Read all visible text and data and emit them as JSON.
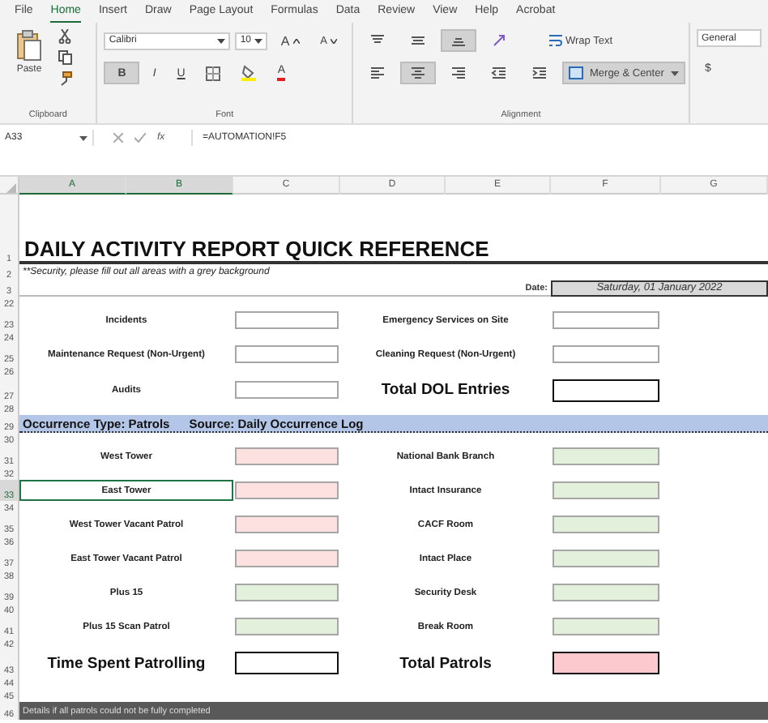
{
  "ribbon": {
    "tabs": [
      {
        "label": "File",
        "selected": false
      },
      {
        "label": "Home",
        "selected": true
      },
      {
        "label": "Insert",
        "selected": false
      },
      {
        "label": "Draw",
        "selected": false
      },
      {
        "label": "Page Layout",
        "selected": false
      },
      {
        "label": "Formulas",
        "selected": false
      },
      {
        "label": "Data",
        "selected": false
      },
      {
        "label": "Review",
        "selected": false
      },
      {
        "label": "View",
        "selected": false
      },
      {
        "label": "Help",
        "selected": false
      },
      {
        "label": "Acrobat",
        "selected": false
      }
    ],
    "clipboard": {
      "paste": "Paste",
      "group": "Clipboard"
    },
    "font": {
      "family": "Calibri",
      "size": "10",
      "grow": "A",
      "shrink": "A",
      "group": "Font",
      "buttons": [
        {
          "kind": "bold",
          "label": "B",
          "pressed": true
        },
        {
          "kind": "italic",
          "label": "I",
          "pressed": false
        },
        {
          "kind": "underline",
          "label": "U",
          "pressed": false
        },
        {
          "kind": "borders",
          "pressed": false
        },
        {
          "kind": "fill",
          "pressed": false
        },
        {
          "kind": "color",
          "label": "A",
          "pressed": false
        }
      ]
    },
    "alignment": {
      "group": "Alignment",
      "wrap": "Wrap Text",
      "merge": {
        "label": "Merge & Center",
        "pressed": true
      },
      "top": [
        {
          "kind": "top",
          "pressed": false
        },
        {
          "kind": "middle",
          "pressed": false
        },
        {
          "kind": "bottom",
          "pressed": true
        },
        {
          "kind": "orientation",
          "pressed": false
        }
      ],
      "bottom": [
        {
          "kind": "left",
          "pressed": false
        },
        {
          "kind": "center",
          "pressed": true
        },
        {
          "kind": "right",
          "pressed": false
        },
        {
          "kind": "outdent",
          "pressed": false
        },
        {
          "kind": "indent",
          "pressed": false
        }
      ]
    },
    "number": {
      "format": "General",
      "currency": "$"
    }
  },
  "formula_bar": {
    "name_box": "A33",
    "fx": "fx",
    "formula": "=AUTOMATION!F5"
  },
  "sheet": {
    "columns": [
      {
        "label": "A",
        "selected": true
      },
      {
        "label": "B",
        "selected": true
      },
      {
        "label": "C",
        "selected": false
      },
      {
        "label": "D",
        "selected": false
      },
      {
        "label": "E",
        "selected": false
      },
      {
        "label": "F",
        "selected": false
      },
      {
        "label": "G",
        "selected": false
      }
    ],
    "rows": [
      {
        "num": "1",
        "kind": "title",
        "text": "DAILY ACTIVITY REPORT QUICK REFERENCE"
      },
      {
        "num": "2",
        "kind": "note",
        "text": "**Security, please fill out all areas with a grey background"
      },
      {
        "num": "3",
        "kind": "date",
        "label": "Date:",
        "value": "Saturday, 01 January 2022"
      },
      {
        "num": "22",
        "kind": "blank"
      },
      {
        "num": "23",
        "kind": "pair",
        "left": {
          "label": "Incidents",
          "kind": "field",
          "color": "#ffffff",
          "selected": false
        },
        "right": {
          "label": "Emergency Services on Site",
          "kind": "field",
          "color": "#ffffff",
          "selected": false
        }
      },
      {
        "num": "24",
        "kind": "blank"
      },
      {
        "num": "25",
        "kind": "pair",
        "left": {
          "label": "Maintenance Request (Non-Urgent)",
          "kind": "field",
          "color": "#ffffff",
          "selected": false
        },
        "right": {
          "label": "Cleaning Request (Non-Urgent)",
          "kind": "field",
          "color": "#ffffff",
          "selected": false
        }
      },
      {
        "num": "26",
        "kind": "blank"
      },
      {
        "num": "27",
        "kind": "pair",
        "left": {
          "label": "Audits",
          "kind": "field",
          "color": "#ffffff",
          "selected": false
        },
        "right": {
          "label": "Total DOL Entries",
          "kind": "total",
          "color": "#ffffff",
          "selected": false
        }
      },
      {
        "num": "28",
        "kind": "blank"
      },
      {
        "num": "29",
        "kind": "section",
        "texts": [
          "Occurrence Type: Patrols",
          "Source: Daily Occurrence Log"
        ]
      },
      {
        "num": "30",
        "kind": "blank"
      },
      {
        "num": "31",
        "kind": "pair",
        "left": {
          "label": "West Tower",
          "kind": "field",
          "color": "#fde0e0",
          "selected": false
        },
        "right": {
          "label": "National Bank Branch",
          "kind": "field",
          "color": "#e3f0dc",
          "selected": false
        }
      },
      {
        "num": "32",
        "kind": "blank"
      },
      {
        "num": "33",
        "kind": "pair",
        "left": {
          "label": "East Tower",
          "kind": "field",
          "color": "#fde0e0",
          "selected": true
        },
        "right": {
          "label": "Intact Insurance",
          "kind": "field",
          "color": "#e3f0dc",
          "selected": false
        }
      },
      {
        "num": "34",
        "kind": "blank"
      },
      {
        "num": "35",
        "kind": "pair",
        "left": {
          "label": "West Tower Vacant Patrol",
          "kind": "field",
          "color": "#fde0e0",
          "selected": false
        },
        "right": {
          "label": "CACF Room",
          "kind": "field",
          "color": "#e3f0dc",
          "selected": false
        }
      },
      {
        "num": "36",
        "kind": "blank"
      },
      {
        "num": "37",
        "kind": "pair",
        "left": {
          "label": "East Tower Vacant Patrol",
          "kind": "field",
          "color": "#fde0e0",
          "selected": false
        },
        "right": {
          "label": "Intact Place",
          "kind": "field",
          "color": "#e3f0dc",
          "selected": false
        }
      },
      {
        "num": "38",
        "kind": "blank"
      },
      {
        "num": "39",
        "kind": "pair",
        "left": {
          "label": "Plus 15",
          "kind": "field",
          "color": "#e3f0dc",
          "selected": false
        },
        "right": {
          "label": "Security Desk",
          "kind": "field",
          "color": "#e3f0dc",
          "selected": false
        }
      },
      {
        "num": "40",
        "kind": "blank"
      },
      {
        "num": "41",
        "kind": "pair",
        "left": {
          "label": "Plus 15 Scan Patrol",
          "kind": "field",
          "color": "#e3f0dc",
          "selected": false
        },
        "right": {
          "label": "Break Room",
          "kind": "field",
          "color": "#e3f0dc",
          "selected": false
        }
      },
      {
        "num": "42",
        "kind": "blank"
      },
      {
        "num": "43",
        "kind": "pair",
        "left": {
          "label": "Time Spent Patrolling",
          "kind": "total",
          "color": "#ffffff",
          "selected": false
        },
        "right": {
          "label": "Total Patrols",
          "kind": "total",
          "color": "#fcc9cf",
          "selected": false
        }
      },
      {
        "num": "44",
        "kind": "blank"
      },
      {
        "num": "45",
        "kind": "blank"
      },
      {
        "num": "46",
        "kind": "banner",
        "text": "Details if all patrols could not be fully completed"
      }
    ]
  }
}
